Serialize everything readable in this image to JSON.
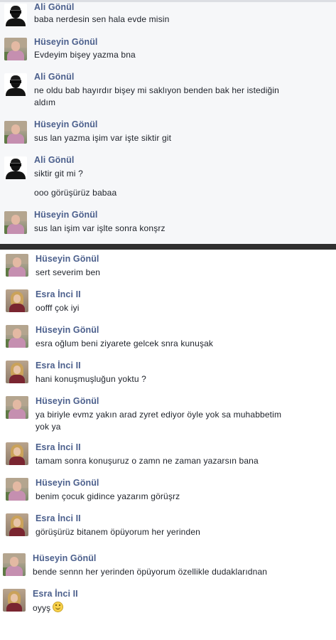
{
  "top_conversation": {
    "messages": [
      {
        "author": "Ali Gönül",
        "lines": [
          "baba nerdesin sen hala evde misin"
        ]
      },
      {
        "author": "Hüseyin Gönül",
        "lines": [
          "Evdeyim bişey yazma bna"
        ]
      },
      {
        "author": "Ali Gönül",
        "lines": [
          "ne oldu bab hayırdır bişey mi saklıyon benden bak her istediğin",
          "aldım"
        ]
      },
      {
        "author": "Hüseyin Gönül",
        "lines": [
          "sus lan yazma işim var işte siktir git"
        ]
      },
      {
        "author": "Ali Gönül",
        "lines": [
          "siktir git mi ?",
          "ooo görüşürüz babaa"
        ]
      },
      {
        "author": "Hüseyin Gönül",
        "lines": [
          "sus lan işim var işlte sonra konşrz"
        ]
      }
    ]
  },
  "bottom_conversation": {
    "messages": [
      {
        "author": "Hüseyin Gönül",
        "lines": [
          "sert severim ben"
        ]
      },
      {
        "author": "Esra İnci II",
        "lines": [
          "oofff çok iyi"
        ]
      },
      {
        "author": "Hüseyin Gönül",
        "lines": [
          "esra oğlum beni ziyarete gelcek snra kunuşak"
        ]
      },
      {
        "author": "Esra İnci II",
        "lines": [
          "hani konuşmuşluğun yoktu ?"
        ]
      },
      {
        "author": "Hüseyin Gönül",
        "lines": [
          "ya biriyle evmz yakın arad zyret ediyor öyle yok sa muhabbetim",
          "yok ya"
        ]
      },
      {
        "author": "Esra İnci II",
        "lines": [
          "tamam sonra konuşuruz o zamn ne zaman yazarsın bana"
        ]
      },
      {
        "author": "Hüseyin Gönül",
        "lines": [
          "benim çocuk gidince yazarım görüşrz"
        ]
      },
      {
        "author": "Esra İnci II",
        "lines": [
          "görüşürüz bitanem öpüyorum her yerinden"
        ]
      },
      {
        "author": "Hüseyin Gönül",
        "lines": [
          "bende sennn her yerinden öpüyorum özellikle dudaklarıdnan"
        ]
      },
      {
        "author": "Esra İnci II",
        "lines": [
          "oyyş"
        ],
        "emoji": "smiley-icon"
      }
    ]
  }
}
